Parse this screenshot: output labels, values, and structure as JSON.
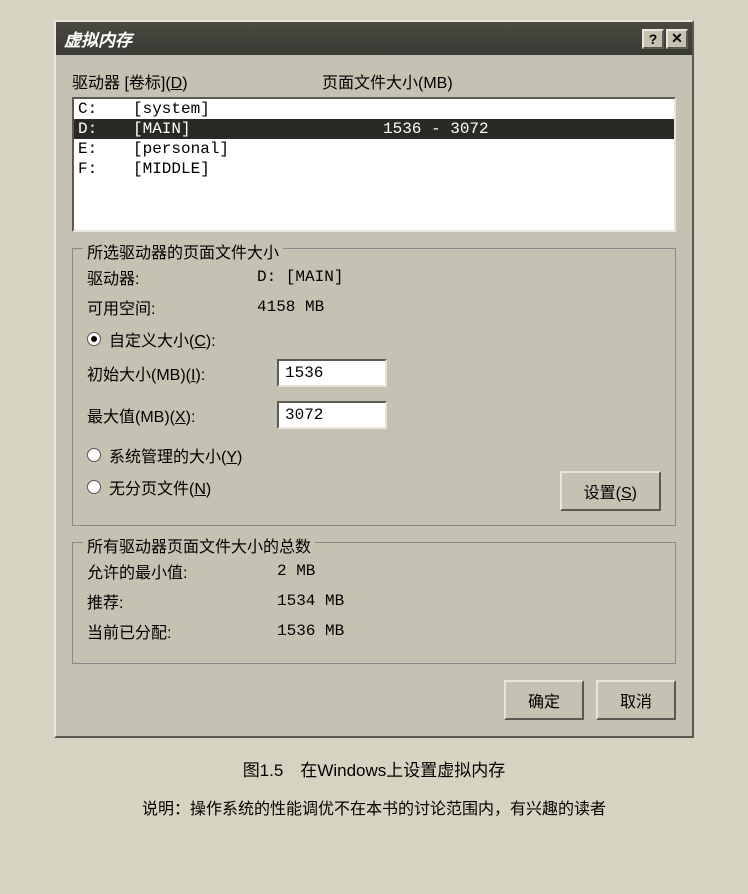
{
  "titlebar": {
    "title": "虚拟内存"
  },
  "header": {
    "drives_label": "驱动器 [卷标](D)",
    "paging_label": "页面文件大小(MB)"
  },
  "drives": [
    {
      "drv": "C:",
      "label": "[system]",
      "size": "",
      "selected": false
    },
    {
      "drv": "D:",
      "label": "[MAIN]",
      "size": "1536 - 3072",
      "selected": true
    },
    {
      "drv": "E:",
      "label": "[personal]",
      "size": "",
      "selected": false
    },
    {
      "drv": "F:",
      "label": "[MIDDLE]",
      "size": "",
      "selected": false
    }
  ],
  "selected_group": {
    "legend": "所选驱动器的页面文件大小",
    "drive_label": "驱动器:",
    "drive_value": "D:   [MAIN]",
    "space_label": "可用空间:",
    "space_value": "4158 MB",
    "radio_custom": "自定义大小(C):",
    "initial_label": "初始大小(MB)(I):",
    "initial_value": "1536",
    "max_label": "最大值(MB)(X):",
    "max_value": "3072",
    "radio_system": "系统管理的大小(Y)",
    "radio_none": "无分页文件(N)",
    "set_button": "设置(S)"
  },
  "total_group": {
    "legend": "所有驱动器页面文件大小的总数",
    "min_label": "允许的最小值:",
    "min_value": "2 MB",
    "rec_label": "推荐:",
    "rec_value": "1534 MB",
    "cur_label": "当前已分配:",
    "cur_value": "1536 MB"
  },
  "buttons": {
    "ok": "确定",
    "cancel": "取消"
  },
  "caption": "图1.5　在Windows上设置虚拟内存",
  "note": "说明：操作系统的性能调优不在本书的讨论范围内，有兴趣的读者"
}
